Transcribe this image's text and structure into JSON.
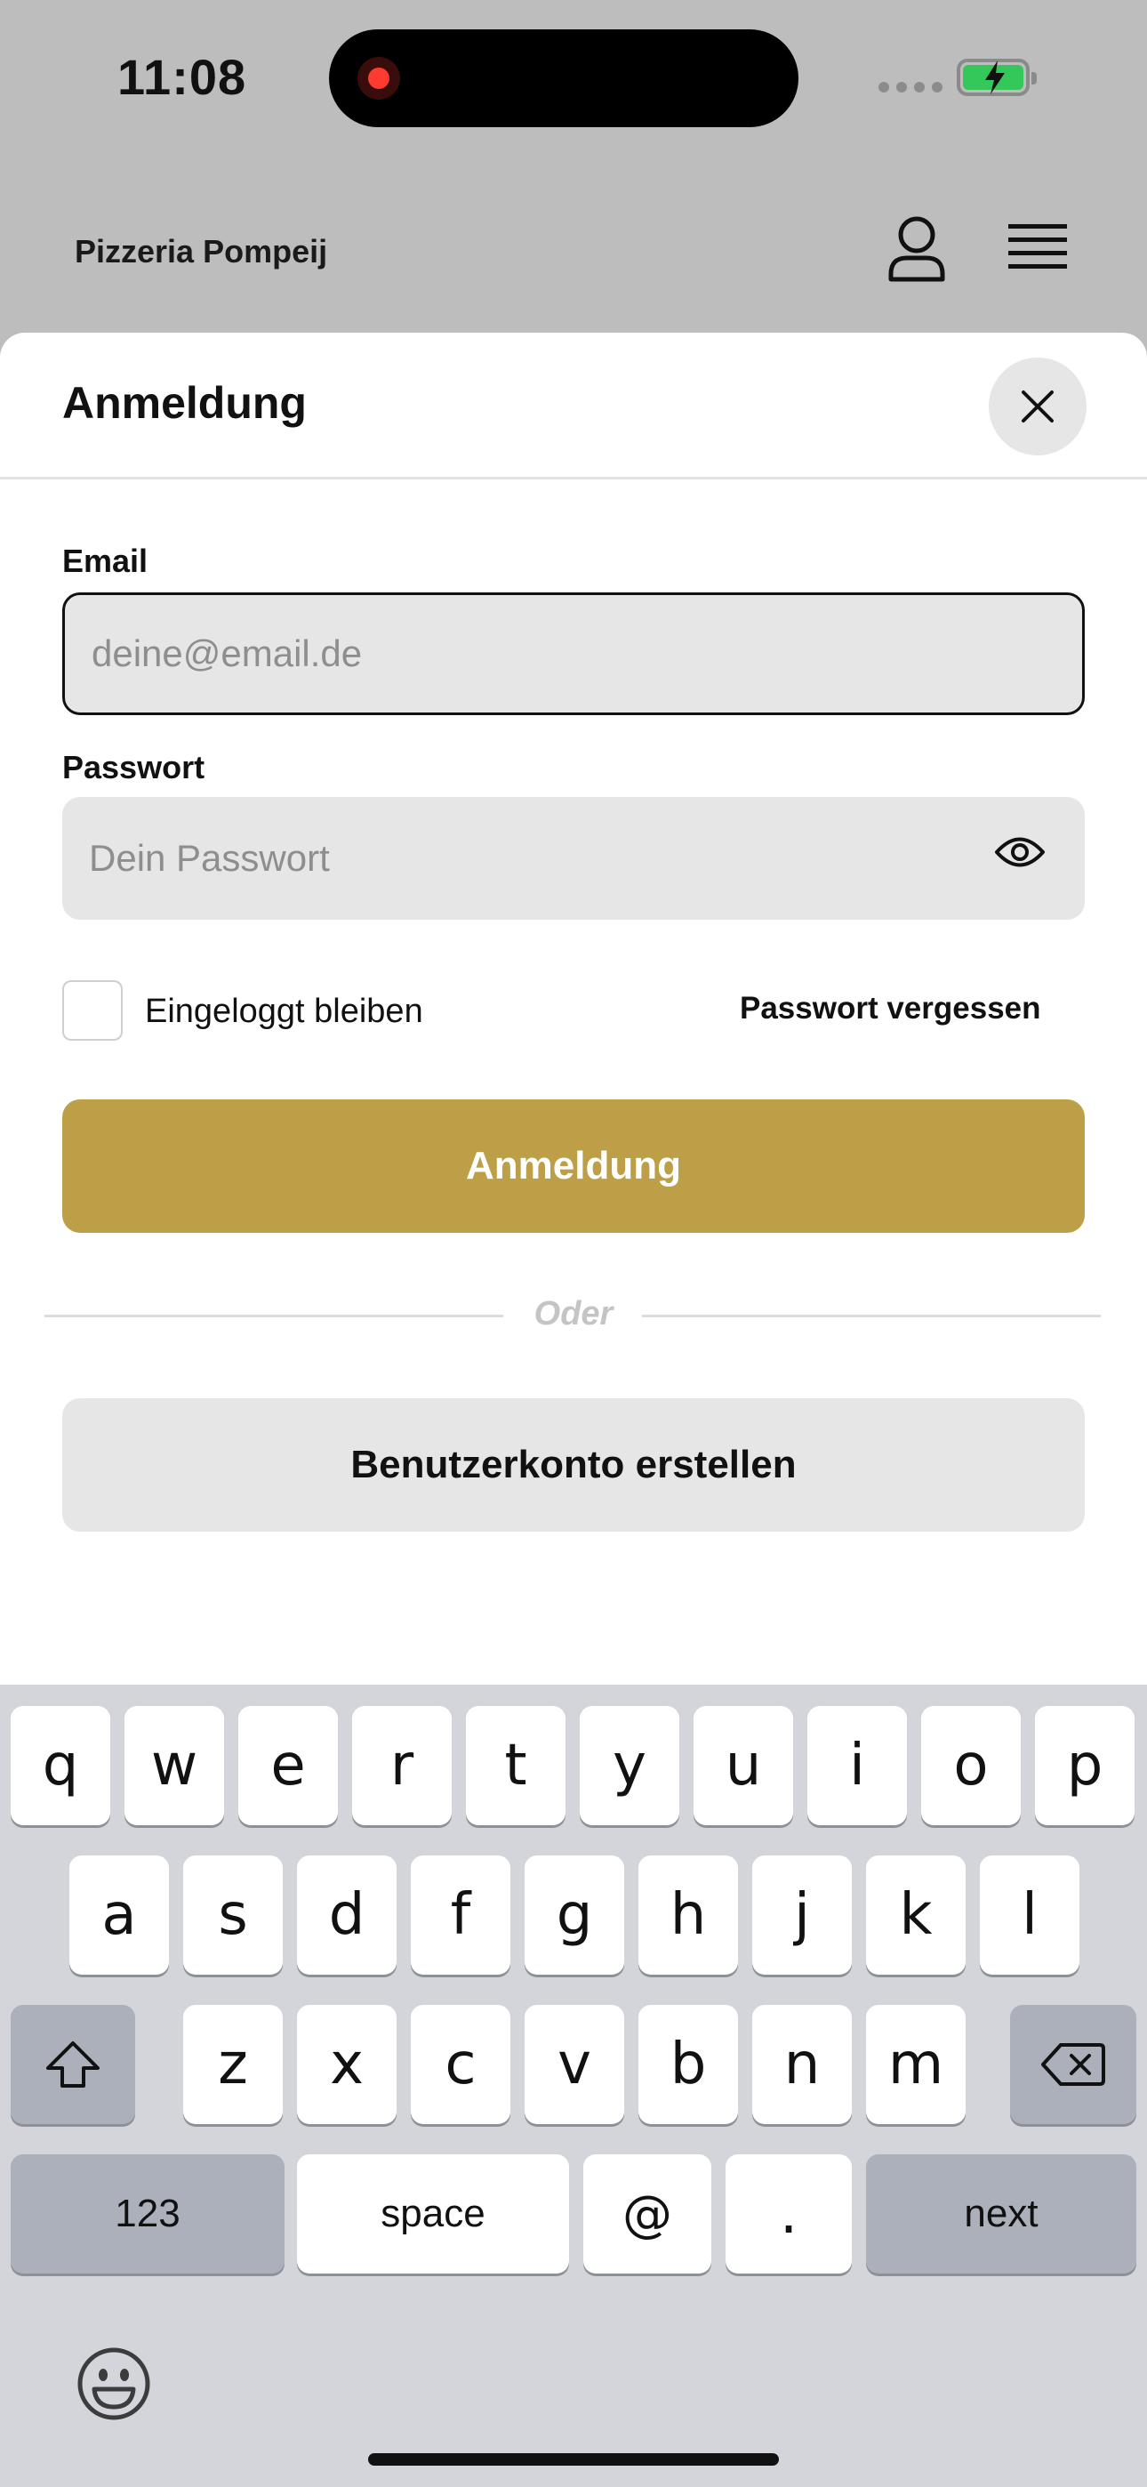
{
  "status_bar": {
    "time": "11:08"
  },
  "background": {
    "title": "Pizzeria Pompeij",
    "icons": [
      "user-icon",
      "menu-icon"
    ]
  },
  "sheet": {
    "title": "Anmeldung",
    "close_icon": "close-icon",
    "email": {
      "label": "Email",
      "placeholder": "deine@email.de",
      "value": ""
    },
    "password": {
      "label": "Passwort",
      "placeholder": "Dein Passwort",
      "value": "",
      "toggle_icon": "eye-icon"
    },
    "remember": {
      "label": "Eingeloggt bleiben",
      "checked": false
    },
    "forgot_label": "Passwort vergessen",
    "login_label": "Anmeldung",
    "or_label": "Oder",
    "register_label": "Benutzerkonto erstellen"
  },
  "keyboard": {
    "row1": [
      "q",
      "w",
      "e",
      "r",
      "t",
      "y",
      "u",
      "i",
      "o",
      "p"
    ],
    "row2": [
      "a",
      "s",
      "d",
      "f",
      "g",
      "h",
      "j",
      "k",
      "l"
    ],
    "row3": [
      "z",
      "x",
      "c",
      "v",
      "b",
      "n",
      "m"
    ],
    "numbers_label": "123",
    "space_label": "space",
    "at_label": "@",
    "dot_label": ".",
    "next_label": "next",
    "icons": [
      "shift-icon",
      "backspace-icon",
      "emoji-icon"
    ]
  },
  "colors": {
    "accent": "#bc9f47",
    "field_bg": "#e6e6e6",
    "keyboard_bg": "#d3d5db"
  }
}
